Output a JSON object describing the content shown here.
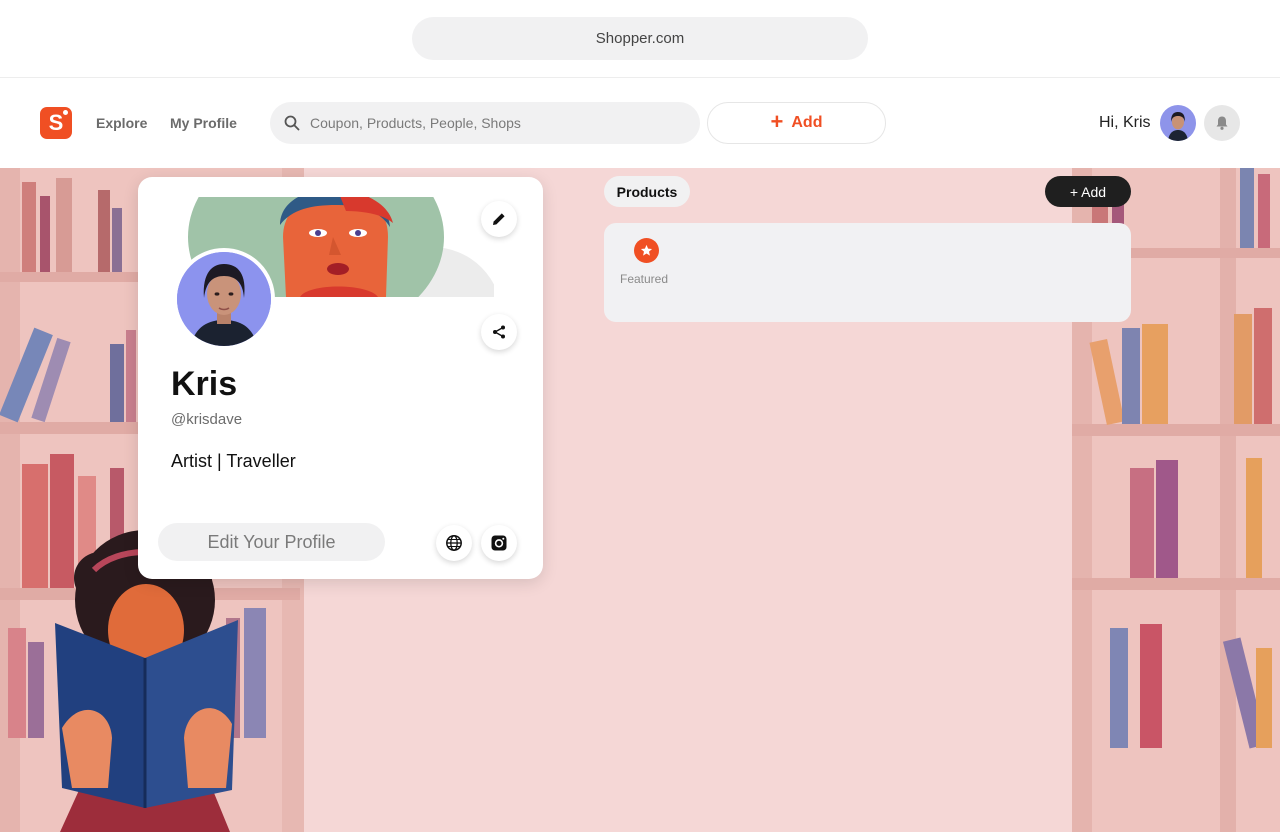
{
  "browser": {
    "url": "Shopper.com"
  },
  "header": {
    "logo_letter": "S",
    "nav": {
      "explore": "Explore",
      "my_profile": "My Profile"
    },
    "search": {
      "placeholder": "Coupon, Products, People, Shops"
    },
    "add_label": "Add",
    "greeting": "Hi, Kris"
  },
  "profile": {
    "name": "Kris",
    "handle": "@krisdave",
    "bio": "Artist | Traveller",
    "edit_label": "Edit Your Profile"
  },
  "products": {
    "tab_label": "Products",
    "add_label": "+ Add",
    "featured_label": "Featured"
  },
  "colors": {
    "accent": "#f04f23",
    "background_scene": "#f5d7d6",
    "dark_button": "#1f1f1f",
    "pill_gray": "#f1f1f2"
  },
  "icons": [
    "search-icon",
    "plus-icon",
    "bell-icon",
    "pencil-icon",
    "share-icon",
    "globe-icon",
    "instagram-icon",
    "star-icon"
  ]
}
